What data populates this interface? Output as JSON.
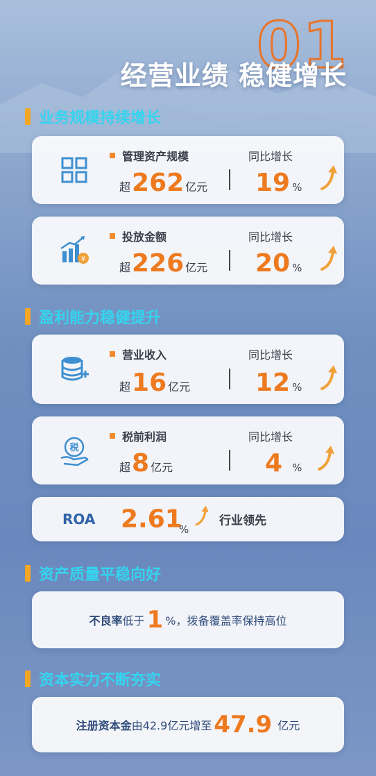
{
  "hero": {
    "number": "01",
    "title": "经营业绩 稳健增长"
  },
  "sections": {
    "scale": "业务规模持续增长",
    "profit": "盈利能力稳健提升",
    "quality": "资产质量平稳向好",
    "capital": "资本实力不断夯实"
  },
  "cards": {
    "assets": {
      "icon": "grid-icon",
      "label": "管理资产规模",
      "prefix": "超",
      "value": "262",
      "unit": "亿元",
      "yoy_label": "同比增长",
      "yoy": "19",
      "pct": "%"
    },
    "lending": {
      "icon": "growth-chart-yuan-icon",
      "label": "投放金额",
      "prefix": "超",
      "value": "226",
      "unit": "亿元",
      "yoy_label": "同比增长",
      "yoy": "20",
      "pct": "%"
    },
    "revenue": {
      "icon": "database-plus-icon",
      "label": "营业收入",
      "prefix": "超",
      "value": "16",
      "unit": "亿元",
      "yoy_label": "同比增长",
      "yoy": "12",
      "pct": "%"
    },
    "pretax": {
      "icon": "tax-hand-icon",
      "label": "税前利润",
      "prefix": "超",
      "value": "8",
      "unit": "亿元",
      "yoy_label": "同比增长",
      "yoy": "4",
      "pct": "%"
    }
  },
  "roa": {
    "label": "ROA",
    "value": "2.61",
    "pct": "%",
    "note": "行业领先"
  },
  "quality": {
    "text1": "不良率",
    "text2": "低于",
    "value": "1",
    "text3": "%，拨备覆盖率保持高位"
  },
  "capital": {
    "text1": "注册资本金",
    "text2": "由42.9亿元增至",
    "value": "47.9",
    "text3": " 亿元"
  },
  "colors": {
    "accent": "#ee7a20",
    "section": "#35d4ee",
    "bar": "#f5a623",
    "icon": "#3e8fd0"
  }
}
